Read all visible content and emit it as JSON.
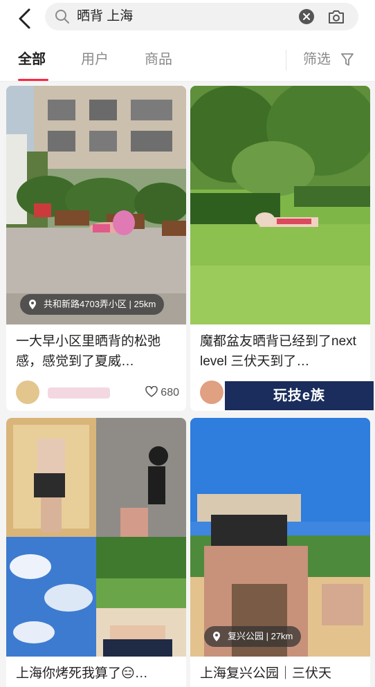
{
  "search": {
    "query": "晒背 上海",
    "icons": {
      "back": "chevron-left-icon",
      "search": "magnifier-icon",
      "clear": "clear-circle-icon",
      "camera": "camera-search-icon"
    }
  },
  "tabs": [
    {
      "label": "全部",
      "active": true
    },
    {
      "label": "用户",
      "active": false
    },
    {
      "label": "商品",
      "active": false
    }
  ],
  "filter": {
    "label": "筛选",
    "icon": "funnel-icon"
  },
  "accent_color": "#ff2442",
  "cards": [
    {
      "location": "共和新路4703弄小区 | 25km",
      "title": "一大早小区里晒背的松弛感，感觉到了夏威…",
      "likes": "680"
    },
    {
      "title": "魔都盆友晒背已经到了next level 三伏天到了…"
    },
    {
      "title": "上海你烤死我算了😑…"
    },
    {
      "location": "复兴公园 | 27km",
      "title": "上海复兴公园｜三伏天"
    }
  ],
  "watermark": "玩技e族"
}
